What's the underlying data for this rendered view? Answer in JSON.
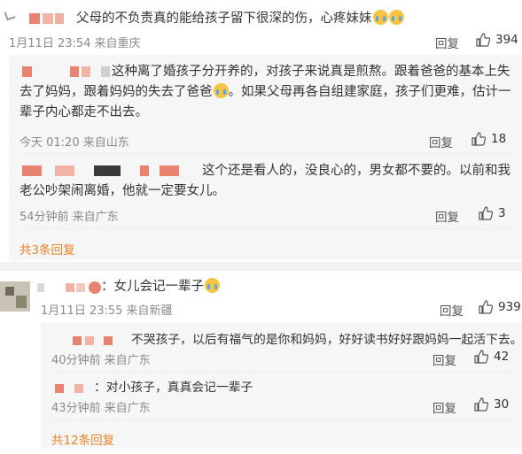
{
  "colors": {
    "accent_orange": "#e8832a",
    "mosaic_red": "#e8836f",
    "mosaic_dark": "#444444",
    "meta_gray": "#8a8a8a",
    "panel_bg": "#f6f6f6"
  },
  "card1": {
    "comment_text": "父母的不负责真的能给孩子留下很深的伤，心疼妹妹",
    "emoji_icons": [
      "crying-face-icon",
      "crying-face-icon"
    ],
    "time": "1月11日 23:54 来自重庆",
    "reply_label": "回复",
    "like_count": "394",
    "replies": [
      {
        "text": "这种离了婚孩子分开养的，对孩子来说真是煎熬。跟着爸爸的基本上失去了妈妈，跟着妈妈的失去了爸爸",
        "text_tail": "。如果父母再各自组建家庭，孩子们更难，估计一辈子内心都走不出去。",
        "time": "今天 01:20 来自山东",
        "reply_label": "回复",
        "like_count": "18"
      },
      {
        "text": "这个还是看人的，没良心的，男女都不要的。以前和我老公吵架闹离婚，他就一定要女儿。",
        "time": "54分钟前 来自广东",
        "reply_label": "回复",
        "like_count": "3"
      }
    ],
    "more_replies": "共3条回复"
  },
  "card2": {
    "comment_text": "：女儿会记一辈子",
    "time": "1月11日 23:55 来自新疆",
    "reply_label": "回复",
    "like_count": "939",
    "replies": [
      {
        "text": "不哭孩子，以后有福气的是你和妈妈，好好读书好好跟妈妈一起活下去。",
        "time": "40分钟前 来自广东",
        "reply_label": "回复",
        "like_count": "42"
      },
      {
        "text": "：对小孩子，真真会记一辈子",
        "time": "43分钟前 来自广东",
        "reply_label": "回复",
        "like_count": "30"
      }
    ],
    "more_replies": "共12条回复"
  }
}
